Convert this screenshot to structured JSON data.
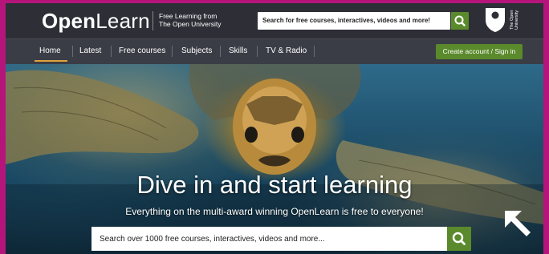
{
  "header": {
    "logo_bold": "Open",
    "logo_light": "Learn",
    "tagline_line1": "Free Learning from",
    "tagline_line2": "The Open University",
    "search_placeholder": "Search for free courses, interactives, videos and more!",
    "search_icon": "search-icon",
    "university_text": "The Open University"
  },
  "nav": {
    "items": [
      {
        "label": "Home",
        "active": true
      },
      {
        "label": "Latest"
      },
      {
        "label": "Free courses"
      },
      {
        "label": "Subjects"
      },
      {
        "label": "Skills"
      },
      {
        "label": "TV & Radio"
      }
    ],
    "signin_label": "Create account / Sign in"
  },
  "hero": {
    "title": "Dive in and start learning",
    "subtitle": "Everything on the multi-award winning OpenLearn is free to everyone!",
    "search_placeholder": "Search over 1000 free courses, interactives, videos and more...",
    "search_icon": "search-icon",
    "image_subject": "sea turtle underwater",
    "overlay_icon": "arrow-up-left-icon"
  },
  "colors": {
    "page_border": "#b5157a",
    "header_bg": "#2d2e36",
    "nav_bg": "#3b3d46",
    "accent_green": "#5a8a2c",
    "active_underline": "#e2a33b"
  }
}
